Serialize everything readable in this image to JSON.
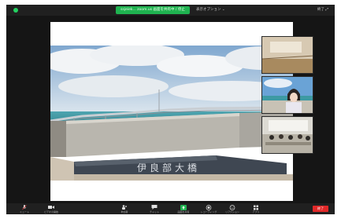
{
  "topbar": {
    "share_banner": "ssjeiek... zoom.us 画面を共有中 / 停止",
    "view_options": "表示オプション ⌄",
    "fullscreen": "終了 ⤢"
  },
  "slide": {
    "sign_text": "伊良部大橋"
  },
  "gallery": {
    "tiles": [
      {
        "label": ""
      },
      {
        "label": ""
      },
      {
        "label": ""
      }
    ]
  },
  "toolbar": {
    "items": [
      {
        "label": "ミュート",
        "icon": "microphone-icon"
      },
      {
        "label": "ビデオの開始",
        "icon": "video-camera-icon"
      },
      {
        "label": "参加者",
        "icon": "participants-icon"
      },
      {
        "label": "チャット",
        "icon": "chat-icon"
      },
      {
        "label": "画面を共有",
        "icon": "share-screen-icon"
      },
      {
        "label": "レコーディング",
        "icon": "record-icon"
      },
      {
        "label": "リアクション",
        "icon": "reaction-icon"
      },
      {
        "label": "アプリ",
        "icon": "apps-icon"
      }
    ],
    "end_label": "終了"
  },
  "colors": {
    "share_green": "#1fb350",
    "end_red": "#e02828",
    "window_bg": "#1a1a1a"
  }
}
